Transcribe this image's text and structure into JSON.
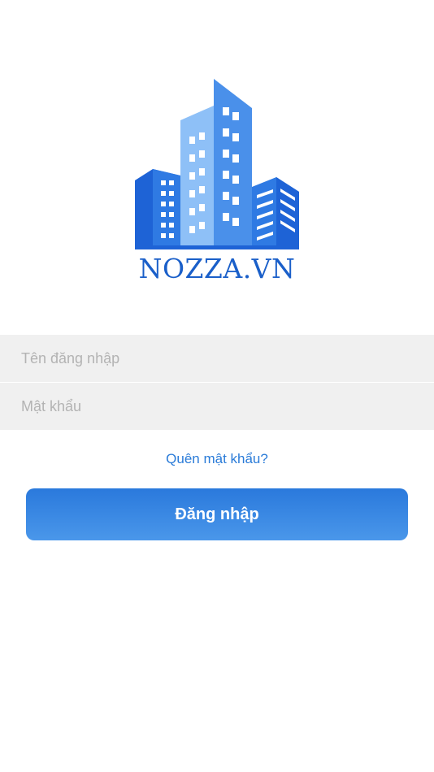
{
  "logo": {
    "brand": "NOZZA.VN",
    "icon": "city-buildings-logo",
    "colors": {
      "dark_blue": "#1e63d6",
      "mid_blue": "#4a90ea",
      "light_blue": "#8ec0f7",
      "brand_text": "#1a5fc9"
    }
  },
  "form": {
    "username_placeholder": "Tên đăng nhập",
    "password_placeholder": "Mật khẩu",
    "username_value": "",
    "password_value": ""
  },
  "forgot_password_label": "Quên mật khẩu?",
  "login_button_label": "Đăng nhập",
  "colors": {
    "accent": "#2a7bd8",
    "field_background": "#f0f0f0",
    "placeholder": "#b3b3b3",
    "background": "#ffffff"
  }
}
